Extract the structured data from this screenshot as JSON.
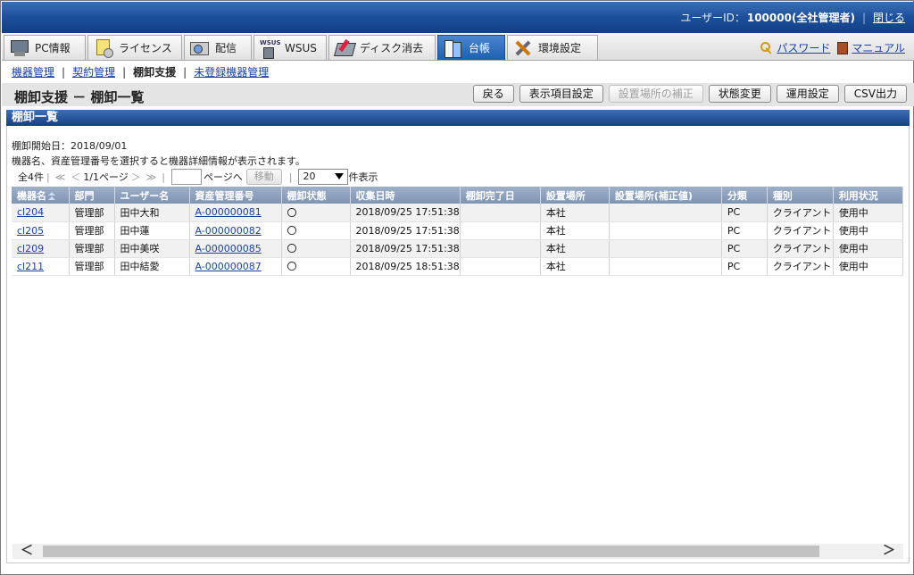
{
  "header": {
    "user_label": "ユーザーID：",
    "user_value": "100000(全社管理者)",
    "close": "閉じる"
  },
  "menu": {
    "tabs": [
      {
        "label": "PC情報",
        "icon": "pc-icon"
      },
      {
        "label": "ライセンス",
        "icon": "license-icon"
      },
      {
        "label": "配信",
        "icon": "distribution-icon"
      },
      {
        "label": "WSUS",
        "icon": "wsus-icon"
      },
      {
        "label": "ディスク消去",
        "icon": "disk-erase-icon"
      },
      {
        "label": "台帳",
        "icon": "ledger-icon"
      },
      {
        "label": "環境設定",
        "icon": "tools-icon"
      }
    ],
    "active": "台帳",
    "wsus_badge": "WSUS",
    "password": "パスワード",
    "manual": "マニュアル"
  },
  "subnav": {
    "items": [
      "機器管理",
      "契約管理",
      "棚卸支援",
      "未登録機器管理"
    ],
    "current": "棚卸支援"
  },
  "page": {
    "title": "棚卸支援 － 棚卸一覧",
    "buttons": [
      "戻る",
      "表示項目設定",
      "設置場所の補正",
      "状態変更",
      "運用設定",
      "CSV出力"
    ],
    "disabled_button": "設置場所の補正"
  },
  "section": {
    "title": "棚卸一覧",
    "start_date": "棚卸開始日：2018/09/01",
    "hint": "機器名、資産管理番号を選択すると機器詳細情報が表示されます。"
  },
  "pager": {
    "total": "全4件",
    "first": "≪",
    "prev": "＜",
    "page_info": "1/1ページ",
    "next": "＞",
    "last": "≫",
    "page_suffix": "ページへ",
    "move": "移動",
    "per_page": "20",
    "per_page_suffix": "件表示"
  },
  "table": {
    "headers": [
      "機器名",
      "部門",
      "ユーザー名",
      "資産管理番号",
      "棚卸状態",
      "収集日時",
      "棚卸完了日",
      "設置場所",
      "設置場所(補正値)",
      "分類",
      "種別",
      "利用状況"
    ],
    "rows": [
      {
        "name": "cl204",
        "dept": "管理部",
        "user": "田中大和",
        "asset": "A-000000081",
        "status": "〇",
        "collected": "2018/09/25 17:51:38",
        "done": "",
        "location": "本社",
        "location_fixed": "",
        "category": "PC",
        "type": "クライアント",
        "usage": "使用中"
      },
      {
        "name": "cl205",
        "dept": "管理部",
        "user": "田中蓮",
        "asset": "A-000000082",
        "status": "〇",
        "collected": "2018/09/25 17:51:38",
        "done": "",
        "location": "本社",
        "location_fixed": "",
        "category": "PC",
        "type": "クライアント",
        "usage": "使用中"
      },
      {
        "name": "cl209",
        "dept": "管理部",
        "user": "田中美咲",
        "asset": "A-000000085",
        "status": "〇",
        "collected": "2018/09/25 17:51:38",
        "done": "",
        "location": "本社",
        "location_fixed": "",
        "category": "PC",
        "type": "クライアント",
        "usage": "使用中"
      },
      {
        "name": "cl211",
        "dept": "管理部",
        "user": "田中結愛",
        "asset": "A-000000087",
        "status": "〇",
        "collected": "2018/09/25 18:51:38",
        "done": "",
        "location": "本社",
        "location_fixed": "",
        "category": "PC",
        "type": "クライアント",
        "usage": "使用中"
      }
    ]
  },
  "scroll": {
    "left": "＜",
    "right": "＞"
  }
}
